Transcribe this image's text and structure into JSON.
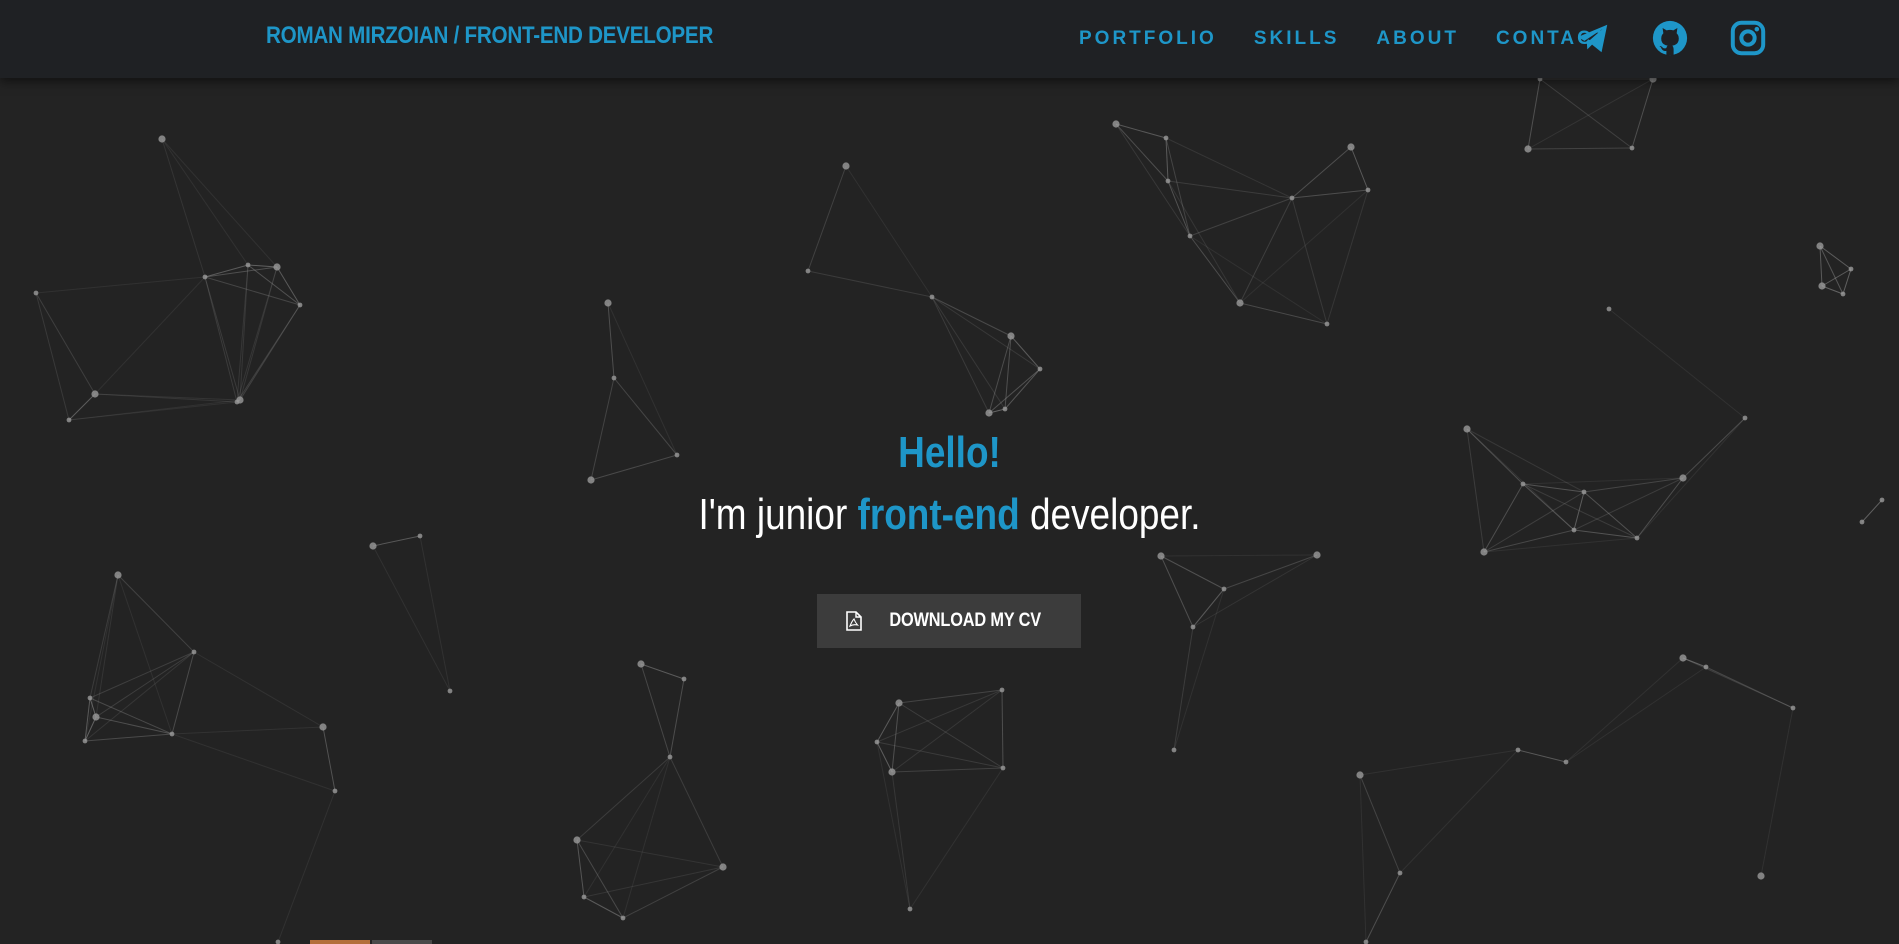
{
  "navbar": {
    "brand": "ROMAN MIRZOIAN / FRONT-END DEVELOPER",
    "links": [
      "PORTFOLIO",
      "SKILLS",
      "ABOUT",
      "CONTACT"
    ],
    "social": [
      "telegram-icon",
      "github-icon",
      "instagram-icon"
    ]
  },
  "hero": {
    "greeting": "Hello!",
    "intro_before": "I'm junior ",
    "intro_accent": "front-end",
    "intro_after": " developer.",
    "cv_button": "DOWNLOAD MY CV",
    "cv_icon": "file-pdf-icon"
  },
  "colors": {
    "background": "#232323",
    "navbar": "#1f2124",
    "accent": "#1e96c8",
    "button": "#3c3c3c",
    "particle": "#9a9a9a"
  }
}
